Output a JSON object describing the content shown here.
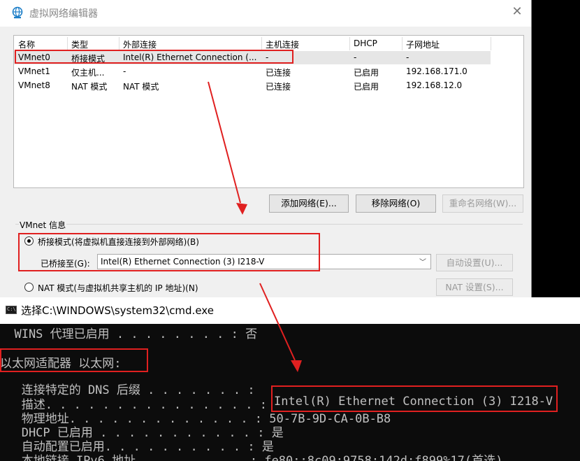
{
  "dialog": {
    "title": "虚拟网络编辑器",
    "close_glyph": "✕"
  },
  "table": {
    "headers": [
      "名称",
      "类型",
      "外部连接",
      "主机连接",
      "DHCP",
      "子网地址"
    ],
    "rows": [
      [
        "VMnet0",
        "桥接模式",
        "Intel(R) Ethernet Connection (...",
        "-",
        "-",
        "-"
      ],
      [
        "VMnet1",
        "仅主机...",
        "-",
        "已连接",
        "已启用",
        "192.168.171.0"
      ],
      [
        "VMnet8",
        "NAT 模式",
        "NAT 模式",
        "已连接",
        "已启用",
        "192.168.12.0"
      ]
    ]
  },
  "buttons": {
    "add_network": "添加网络(E)...",
    "remove_network": "移除网络(O)",
    "rename_network": "重命名网络(W)..."
  },
  "vmnet_info": {
    "group_label": "VMnet 信息",
    "bridged_radio": "桥接模式(将虚拟机直接连接到外部网络)(B)",
    "bridged_to_label": "已桥接至(G):",
    "bridged_to_value": "Intel(R) Ethernet Connection (3) I218-V",
    "auto_settings": "自动设置(U)...",
    "nat_radio": "NAT 模式(与虚拟机共享主机的 IP 地址)(N)",
    "nat_settings": "NAT 设置(S)..."
  },
  "cmd": {
    "icon_text": "C:\\",
    "title": "选择C:\\WINDOWS\\system32\\cmd.exe",
    "lines": {
      "wins": "  WINS 代理已启用 . . . . . . . . : 否",
      "adapter": "以太网适配器 以太网:",
      "dns_suffix": "   连接特定的 DNS 后缀 . . . . . . . :",
      "desc_label": "   描述. . . . . . . . . . . . . . . :",
      "desc_value": "Intel(R) Ethernet Connection (3) I218-V",
      "physical": "   物理地址. . . . . . . . . . . . . : 50-7B-9D-CA-0B-B8",
      "dhcp": "   DHCP 已启用 . . . . . . . . . . . : 是",
      "autoconf": "   自动配置已启用. . . . . . . . . . : 是",
      "ipv6": "   本地链接 IPv6 地址. . . . . . . . : fe80::8c09:9758:142d:f899%17(首选)"
    }
  },
  "colors": {
    "annotation_red": "#e02020",
    "title_icon": "#1e7fc8"
  }
}
